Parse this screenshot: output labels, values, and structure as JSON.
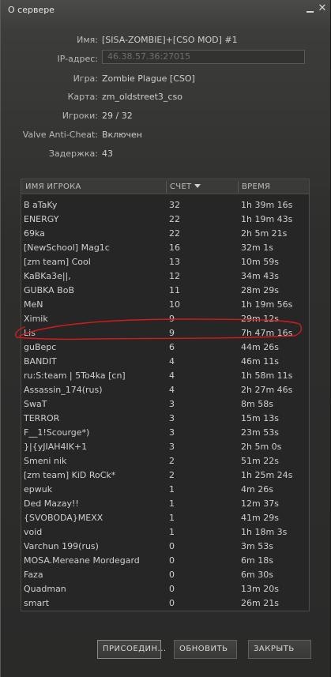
{
  "window": {
    "title": "О сервере"
  },
  "info": {
    "name_label": "Имя:",
    "name_value": "[SISA-ZOMBIE]+[CSO MOD] #1",
    "ip_label": "IP-адрес:",
    "ip_value": "46.38.57.36:27015",
    "game_label": "Игра:",
    "game_value": "Zombie Plague [CSO]",
    "map_label": "Карта:",
    "map_value": "zm_oldstreet3_cso",
    "players_label": "Игроки:",
    "players_value": "29 / 32",
    "vac_label": "Valve Anti-Cheat:",
    "vac_value": "Включен",
    "latency_label": "Задержка:",
    "latency_value": "43"
  },
  "table": {
    "columns": {
      "name": "ИМЯ ИГРОКА",
      "score": "СЧЕТ",
      "time": "ВРЕМЯ"
    },
    "sort_icon": "sort-desc-icon",
    "rows": [
      {
        "name": "В aTaKy",
        "score": "32",
        "time": "1h 39m 16s"
      },
      {
        "name": "ENERGY",
        "score": "22",
        "time": "1h 19m 43s"
      },
      {
        "name": "69ka",
        "score": "22",
        "time": "2h 5m 21s"
      },
      {
        "name": "[NewSchool] Mag1c",
        "score": "16",
        "time": "32m 1s"
      },
      {
        "name": "[zm team] Cool",
        "score": "13",
        "time": "10m 59s"
      },
      {
        "name": "KaBKa3e||,",
        "score": "12",
        "time": "34m 43s"
      },
      {
        "name": "GUBKA BoB",
        "score": "11",
        "time": "28m 29s"
      },
      {
        "name": "MeN",
        "score": "10",
        "time": "1h 19m 56s"
      },
      {
        "name": "Ximik",
        "score": "9",
        "time": "29m 12s"
      },
      {
        "name": "Lis",
        "score": "9",
        "time": "7h 47m 16s"
      },
      {
        "name": "guBepc",
        "score": "6",
        "time": "44m 26s"
      },
      {
        "name": "BANDIT",
        "score": "4",
        "time": "46m 11s"
      },
      {
        "name": "ru:S:team | 5To4ka [cn]",
        "score": "4",
        "time": "1h 58m 11s"
      },
      {
        "name": "Assassin_174(rus)",
        "score": "4",
        "time": "2h 27m 46s"
      },
      {
        "name": "SwaT",
        "score": "3",
        "time": "8m 58s"
      },
      {
        "name": "TERROR",
        "score": "3",
        "time": "15m 13s"
      },
      {
        "name": "F__1!Scourge*)",
        "score": "3",
        "time": "23m 53s"
      },
      {
        "name": "}|{yJIAH4IK+1",
        "score": "3",
        "time": "2h 5m 0s"
      },
      {
        "name": "Smeni nik",
        "score": "2",
        "time": "51m 22s"
      },
      {
        "name": "[zm team] KiD RoCk*",
        "score": "2",
        "time": "1h 25m 24s"
      },
      {
        "name": "epwuk",
        "score": "1",
        "time": "4m 26s"
      },
      {
        "name": "Ded Mazay!!",
        "score": "1",
        "time": "12m 37s"
      },
      {
        "name": "{SVOBODA}MEXX",
        "score": "1",
        "time": "41m 29s"
      },
      {
        "name": "void",
        "score": "1",
        "time": "1h 18m 3s"
      },
      {
        "name": "Varchun 199(rus)",
        "score": "0",
        "time": "3m 53s"
      },
      {
        "name": "MOSA.Mereane Mordegard",
        "score": "0",
        "time": "6m 18s"
      },
      {
        "name": "Faza",
        "score": "0",
        "time": "6m 30s"
      },
      {
        "name": "Quadman",
        "score": "0",
        "time": "13m 20s"
      },
      {
        "name": "smart",
        "score": "0",
        "time": "26m 21s"
      }
    ]
  },
  "buttons": {
    "join": "ПРИСОЕДИН...",
    "refresh": "ОБНОВИТЬ",
    "close": "ЗАКРЫТЬ"
  },
  "annotation": {
    "color": "#d21c1c",
    "highlighted_player": "Lis"
  }
}
